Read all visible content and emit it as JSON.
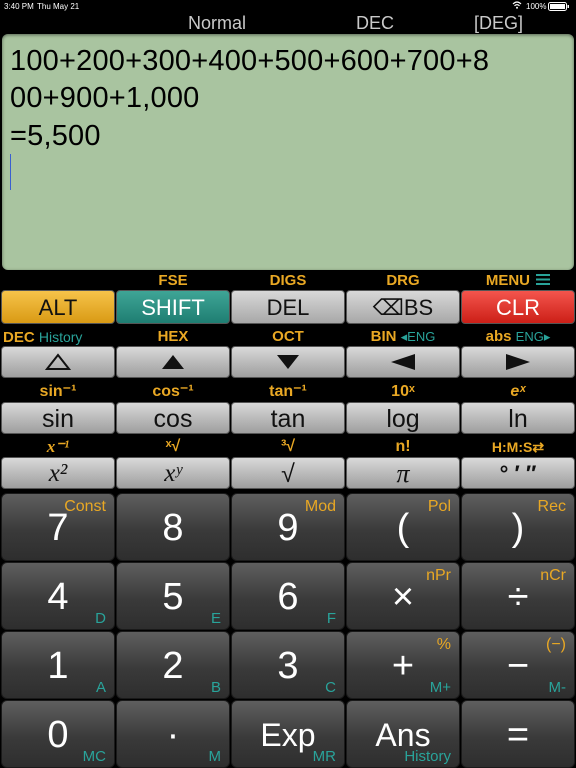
{
  "status": {
    "time": "3:40 PM",
    "date": "Thu May 21",
    "battery": "100%",
    "wifi_icon": "wifi-icon",
    "battery_icon": "battery-icon"
  },
  "modebar": {
    "mode": "Normal",
    "base": "DEC",
    "angle": "[DEG]"
  },
  "display": {
    "line1": "100+200+300+400+500+600+700+8",
    "line2": "00+900+1,000",
    "result": "=5,500"
  },
  "row1_labels": {
    "fse": "FSE",
    "digs": "DIGS",
    "drg": "DRG",
    "menu": "MENU"
  },
  "row1_keys": {
    "alt": "ALT",
    "shift": "SHIFT",
    "del": "DEL",
    "bs": "⌫BS",
    "clr": "CLR"
  },
  "row2_labels": {
    "dec": "DEC",
    "history": "History",
    "hex": "HEX",
    "oct": "OCT",
    "bin": "BIN",
    "eng_left": "◂ENG",
    "abs": "abs",
    "eng_right": "ENG▸"
  },
  "row3_labels": {
    "asin": "sin⁻¹",
    "acos": "cos⁻¹",
    "atan": "tan⁻¹",
    "ten_x": "10ˣ",
    "e_x": "eˣ"
  },
  "row3_keys": {
    "sin": "sin",
    "cos": "cos",
    "tan": "tan",
    "log": "log",
    "ln": "ln"
  },
  "row4_labels": {
    "inv": "x⁻¹",
    "xroot": "ˣ√",
    "cbrt": "³√",
    "fact": "n!",
    "hms": "H:M:S⇄"
  },
  "row4_keys": {
    "sq": "x²",
    "pow": "xʸ",
    "sqrt": "√",
    "pi": "π",
    "dms": "° ′ ″"
  },
  "keys": [
    {
      "main": "7",
      "tr": "Const",
      "br": ""
    },
    {
      "main": "8",
      "tr": "",
      "br": ""
    },
    {
      "main": "9",
      "tr": "Mod",
      "br": ""
    },
    {
      "main": "(",
      "tr": "Pol",
      "br": ""
    },
    {
      "main": ")",
      "tr": "Rec",
      "br": ""
    },
    {
      "main": "4",
      "tr": "",
      "br": "D"
    },
    {
      "main": "5",
      "tr": "",
      "br": "E"
    },
    {
      "main": "6",
      "tr": "",
      "br": "F"
    },
    {
      "main": "×",
      "tr": "nPr",
      "br": ""
    },
    {
      "main": "÷",
      "tr": "nCr",
      "br": ""
    },
    {
      "main": "1",
      "tr": "",
      "br": "A"
    },
    {
      "main": "2",
      "tr": "",
      "br": "B"
    },
    {
      "main": "3",
      "tr": "",
      "br": "C"
    },
    {
      "main": "+",
      "tr": "%",
      "br": "M+"
    },
    {
      "main": "−",
      "tr": "(−)",
      "br": "M-"
    },
    {
      "main": "0",
      "tr": "",
      "br": "MC"
    },
    {
      "main": "·",
      "tr": "",
      "br": "M"
    },
    {
      "main": "Exp",
      "tr": "",
      "br": "MR"
    },
    {
      "main": "Ans",
      "tr": "",
      "br": "History"
    },
    {
      "main": "=",
      "tr": "",
      "br": ""
    }
  ]
}
